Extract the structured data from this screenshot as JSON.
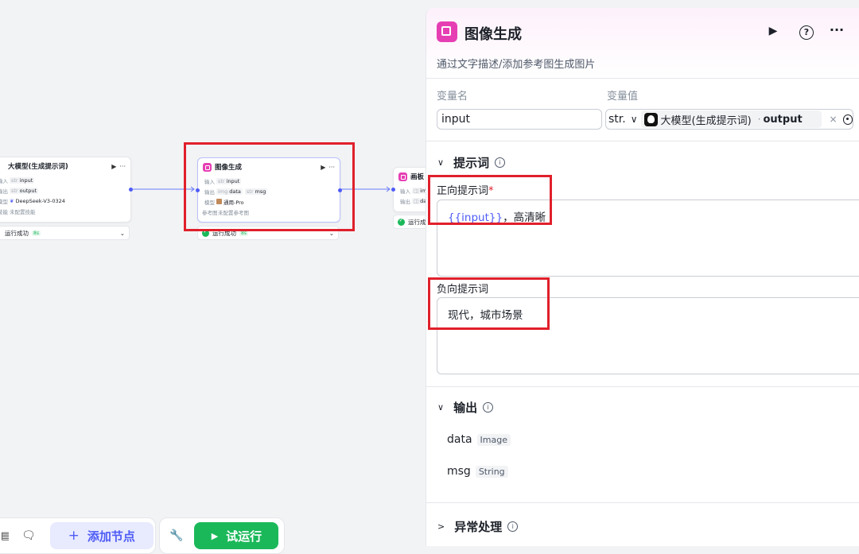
{
  "canvas": {
    "node_llm": {
      "title": "大模型(生成提示词)",
      "row1_label": "输入",
      "row1_type": "str",
      "row1_value": "input",
      "row2_label": "输出",
      "row2_type": "str",
      "row2_value": "output",
      "row3_label": "模型",
      "row3_value": "DeepSeek-V3-0324",
      "row4_label": "技能",
      "row4_value": "未配置技能",
      "status": "运行成功",
      "time": "8s"
    },
    "node_image": {
      "title": "图像生成",
      "row1_label": "输入",
      "row1_type": "str",
      "row1_value": "input",
      "row2_label": "输出",
      "row2_type_a": "img",
      "row2_value_a": "data",
      "row2_type_b": "str",
      "row2_value_b": "msg",
      "row3_label": "模型",
      "row3_value": "通用-Pro",
      "row4_label": "参考图",
      "row4_value": "未配置参考图",
      "status": "运行成功",
      "time": "8s"
    },
    "node_board": {
      "title": "画板",
      "row1_label": "输入",
      "row1_value": "im",
      "row2_label": "输出",
      "row2_value": "da",
      "status": "运行成"
    },
    "toolbar": {
      "add_node": "添加节点",
      "test_run": "试运行"
    }
  },
  "panel": {
    "title": "图像生成",
    "description": "通过文字描述/添加参考图生成图片",
    "var_name_label": "变量名",
    "var_value_label": "变量值",
    "var_name": "input",
    "var_type": "str.",
    "var_ref_node": "大模型(生成提示词)",
    "var_ref_field": "output",
    "prompt_section": "提示词",
    "positive_label": "正向提示词",
    "required_mark": "*",
    "positive_var": "{{input}}",
    "positive_rest": "，高清晰",
    "negative_label": "负向提示词",
    "negative_text": "现代，城市场景",
    "output_section": "输出",
    "outputs": [
      {
        "name": "data",
        "type": "Image"
      },
      {
        "name": "msg",
        "type": "String"
      }
    ],
    "exception_section": "异常处理"
  },
  "colors": {
    "accent": "#4e5cf6",
    "node_icon": "#e63fb3",
    "success": "#1bb85a",
    "highlight": "#e0202b"
  }
}
